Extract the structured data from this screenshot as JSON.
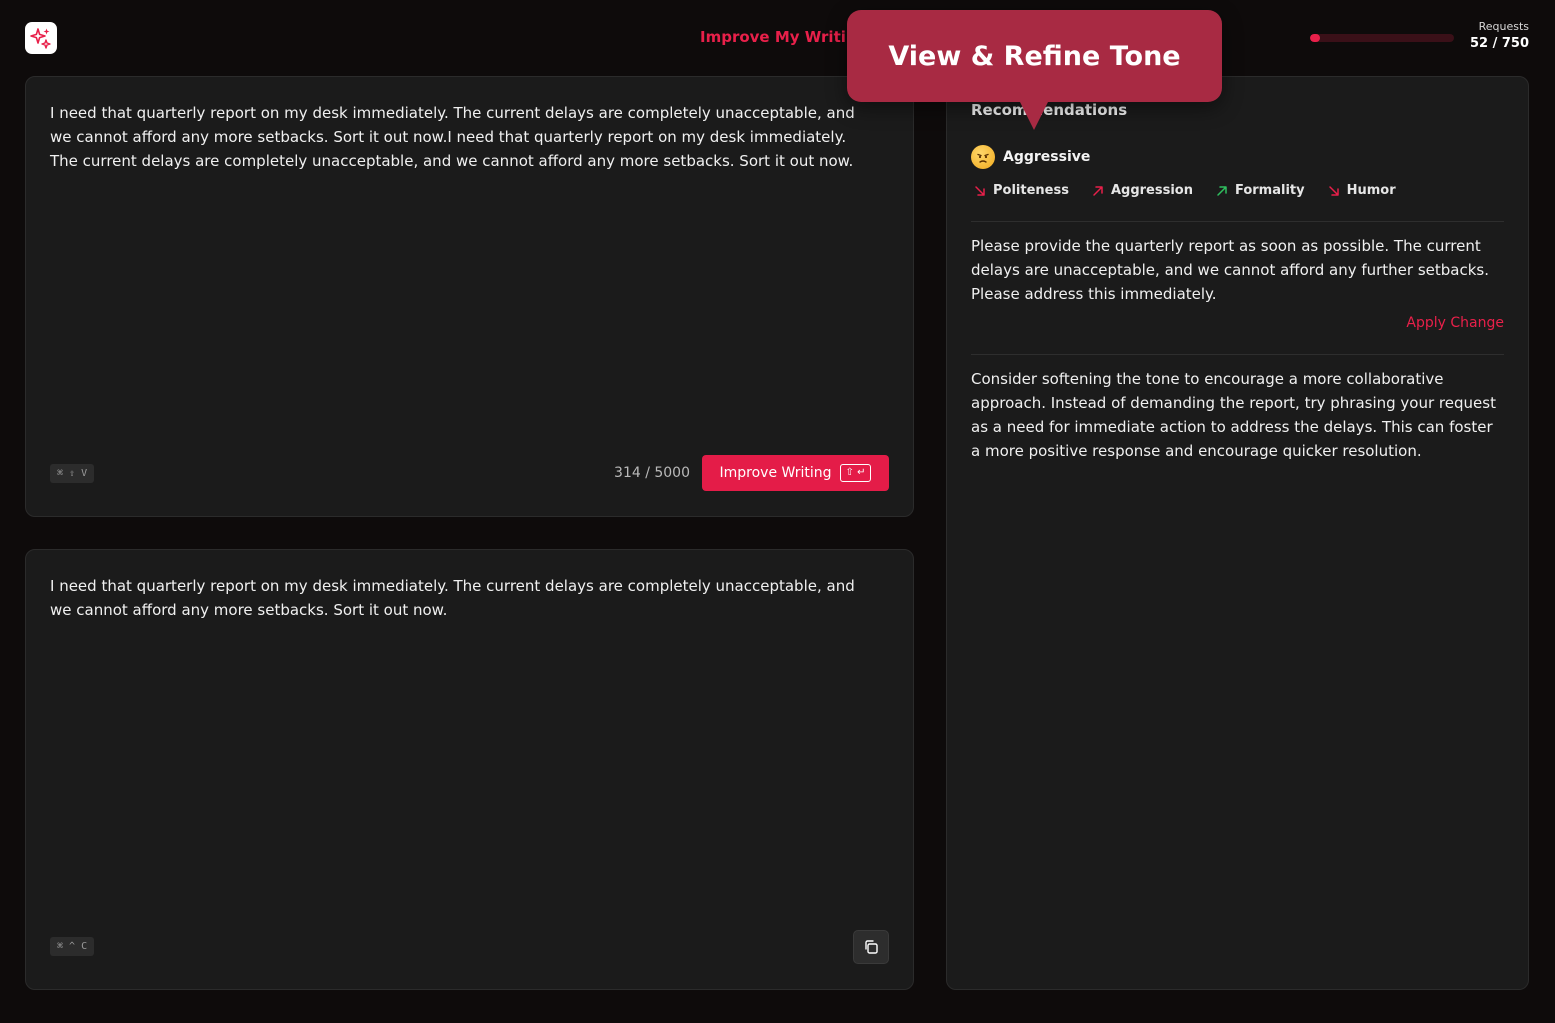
{
  "header": {
    "title": "Improve My Writing",
    "requests_label": "Requests",
    "requests_count": "52 / 750",
    "requests_used": 52,
    "requests_limit": 750
  },
  "input_panel": {
    "text": "I need that quarterly report on my desk immediately. The current delays are completely unacceptable, and we cannot afford any more setbacks. Sort it out now.I need that quarterly report on my desk immediately. The current delays are completely unacceptable, and we cannot afford any more setbacks. Sort it out now.",
    "shortcut": "⌘ ⇧ V",
    "char_count": "314 / 5000",
    "improve_button": "Improve Writing",
    "improve_button_hint": "⇧ ↵"
  },
  "output_panel": {
    "text": "I need that quarterly report on my desk immediately. The current delays are completely unacceptable, and we cannot afford any more setbacks. Sort it out now.",
    "shortcut": "⌘ ^ C",
    "copy_icon": "copy-icon"
  },
  "recommendations": {
    "title": "Recommendations",
    "tone": "Aggressive",
    "tone_icon": "angry-face-emoji",
    "metrics": [
      {
        "label": "Politeness",
        "direction": "down",
        "color": "#e8204a"
      },
      {
        "label": "Aggression",
        "direction": "up",
        "color": "#e8204a"
      },
      {
        "label": "Formality",
        "direction": "up",
        "color": "#2fbf5f"
      },
      {
        "label": "Humor",
        "direction": "down",
        "color": "#e8204a"
      }
    ],
    "suggestion": "Please provide the quarterly report as soon as possible. The current delays are unacceptable, and we cannot afford any further setbacks. Please address this immediately.",
    "apply_change": "Apply Change",
    "advice": "Consider softening the tone to encourage a more collaborative approach. Instead of demanding the report, try phrasing your request as a need for immediate action to address the delays. This can foster a more positive response and encourage quicker resolution."
  },
  "tooltip": {
    "text": "View & Refine Tone"
  },
  "colors": {
    "accent": "#e8204a",
    "tooltip": "#a82a43",
    "panel": "#1b1b1b",
    "background": "#0e0b0b"
  }
}
